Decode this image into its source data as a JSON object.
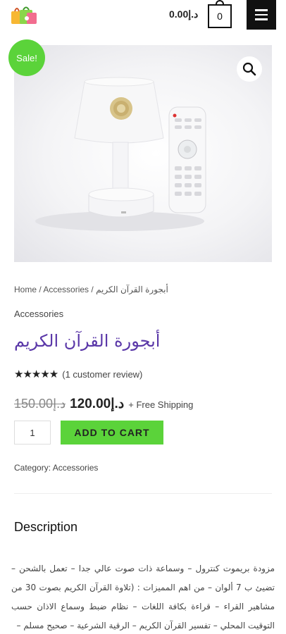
{
  "header": {
    "cart_total": "د.إ0.00",
    "cart_count": "0",
    "logo_icon": "shopping-bags-logo",
    "menu_icon": "hamburger-icon"
  },
  "gallery": {
    "sale_badge": "Sale!",
    "zoom_icon": "magnifier-icon",
    "image_subject": "quran-lamp-speaker-and-remote"
  },
  "breadcrumb": {
    "home": "Home",
    "sep1": " / ",
    "category": "Accessories",
    "sep2": " / ",
    "current": "أبجورة القرآن الكريم"
  },
  "product": {
    "category_label": "Accessories",
    "title": "أبجورة القرآن الكريم",
    "stars": "★★★★★",
    "review_link": "(1 customer review)",
    "old_price": "د.إ150.00",
    "new_price": "د.إ120.00",
    "shipping": "+ Free Shipping",
    "quantity": "1",
    "add_to_cart": "ADD TO CART",
    "meta_label": "Category: ",
    "meta_category": "Accessories"
  },
  "description": {
    "title": "Description",
    "text": "مزودة بريموت كنترول – وسماعة ذات صوت عالي جدا – تعمل بالشحن – تضيئ ب 7 ألوان – من اهم المميزات : (تلاوة القرآن الكريم بصوت 30 من مشاهير القراء – قراءة بكافة اللغات – نظام ضبط وسماع الاذان حسب التوقيت المحلي – تفسير القرآن الكريم – الرقية الشرعية – صحيح مسلم –"
  },
  "colors": {
    "accent_green": "#5bd33a",
    "title_purple": "#5a37a8",
    "header_dark": "#111111"
  }
}
